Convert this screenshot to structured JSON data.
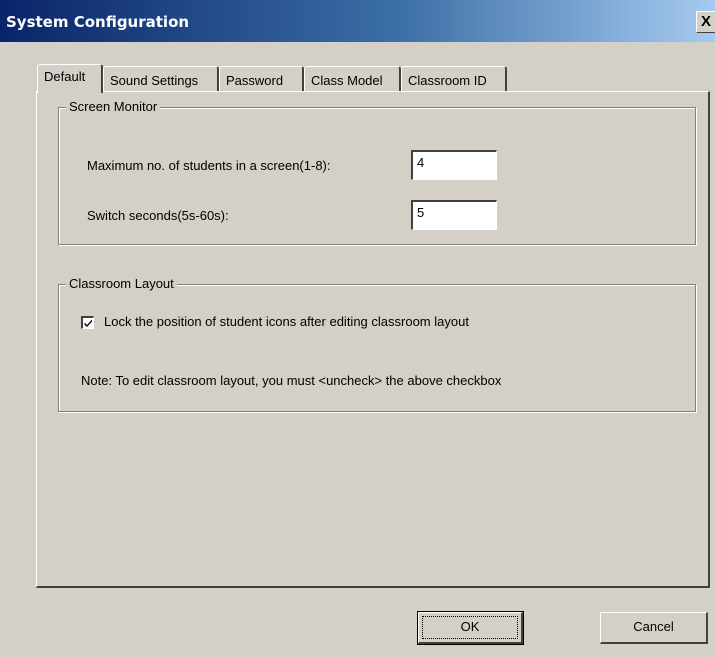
{
  "window": {
    "title": "System Configuration",
    "close_glyph": "X"
  },
  "tabs": [
    {
      "label": "Default",
      "active": true
    },
    {
      "label": "Sound Settings",
      "active": false
    },
    {
      "label": "Password",
      "active": false
    },
    {
      "label": "Class Model",
      "active": false
    },
    {
      "label": "Classroom ID",
      "active": false
    }
  ],
  "screen_monitor": {
    "label": "Screen Monitor",
    "max_students_label": "Maximum no. of students in a screen(1-8):",
    "max_students_value": "4",
    "switch_seconds_label": "Switch seconds(5s-60s):",
    "switch_seconds_value": "5"
  },
  "classroom_layout": {
    "label": "Classroom Layout",
    "lock_checkbox_label": "Lock the position of student icons after editing classroom layout",
    "lock_checked": true,
    "note": "Note: To edit classroom layout, you must <uncheck> the above checkbox"
  },
  "buttons": {
    "ok_label": "OK",
    "cancel_label": "Cancel"
  }
}
